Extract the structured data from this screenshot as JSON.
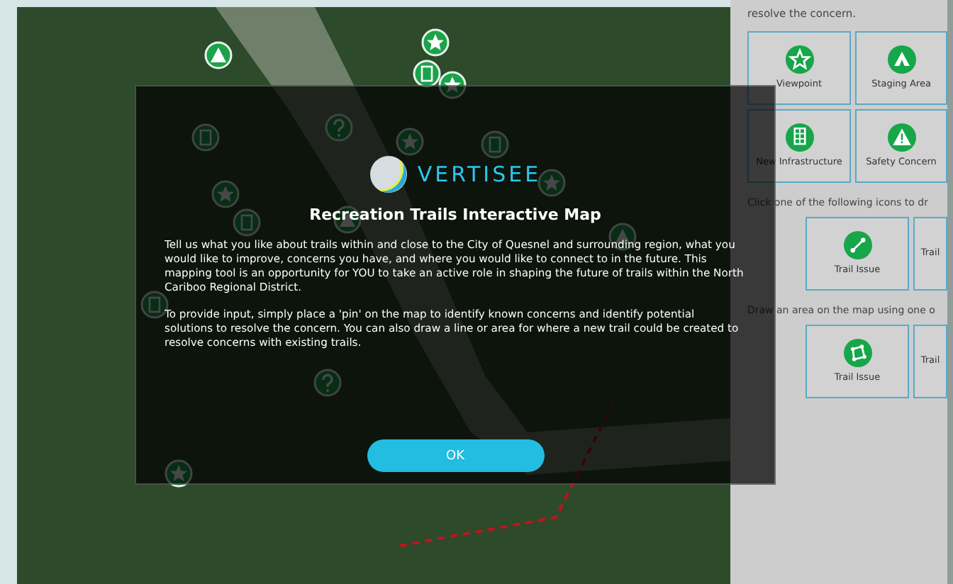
{
  "modal": {
    "brand": "VERTISEE",
    "title": "Recreation Trails Interactive Map",
    "paragraphs": [
      "Tell us what you like about trails within and close to the City of Quesnel and surrounding region, what you would like to improve, concerns you have, and where you would like to connect to in the future. This mapping tool is an opportunity for YOU to take an active role in shaping the future of trails within the North Cariboo Regional District.",
      "To provide input, simply place a 'pin' on the map to identify known concerns and identify potential solutions to resolve the concern. You can also draw a line or area for where a new trail could be created to resolve concerns with existing trails."
    ],
    "button": "OK"
  },
  "panel": {
    "intro": "resolve the concern.",
    "sections": [
      {
        "tiles": [
          {
            "kind": "star",
            "label": "Viewpoint"
          },
          {
            "kind": "tent",
            "label": "Staging Area"
          },
          {
            "kind": "building",
            "label": "New Infrastructure"
          },
          {
            "kind": "warning",
            "label": "Safety Concern"
          }
        ]
      },
      {
        "heading": "Click one of the following icons to dr",
        "tiles": [
          {
            "kind": "line",
            "label": "Trail Issue"
          },
          {
            "kind": "none",
            "label": "Trail"
          }
        ]
      },
      {
        "heading": "Draw an area on the map using one o",
        "tiles": [
          {
            "kind": "polygon",
            "label": "Trail Issue"
          },
          {
            "kind": "none",
            "label": "Trail"
          }
        ]
      }
    ]
  }
}
